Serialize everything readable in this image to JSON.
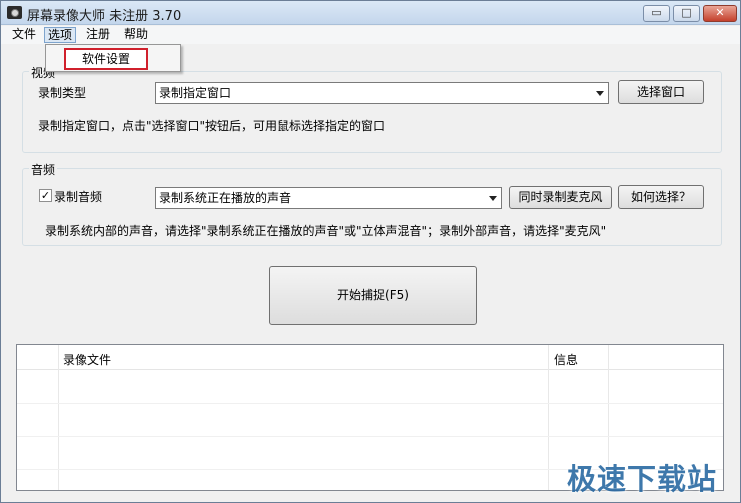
{
  "window": {
    "title": "屏幕录像大师 未注册 3.70",
    "min_label": "▭",
    "max_label": "□",
    "close_label": "✕"
  },
  "menu": {
    "items": [
      "文件",
      "选项",
      "注册",
      "帮助"
    ],
    "dropdown_item": "软件设置"
  },
  "video": {
    "group_label": "视频",
    "type_label": "录制类型",
    "type_value": "录制指定窗口",
    "select_window_button": "选择窗口",
    "hint": "录制指定窗口，点击\"选择窗口\"按钮后，可用鼠标选择指定的窗口"
  },
  "audio": {
    "group_label": "音频",
    "record_audio_label": "录制音频",
    "record_audio_checked": true,
    "source_value": "录制系统正在播放的声音",
    "mic_button": "同时录制麦克风",
    "how_button": "如何选择？",
    "hint": "录制系统内部的声音，请选择\"录制系统正在播放的声音\"或\"立体声混音\"；录制外部声音，请选择\"麦克风\""
  },
  "capture": {
    "start_button": "开始捕捉(F5)"
  },
  "list": {
    "columns": [
      "",
      "录像文件",
      "信息",
      ""
    ]
  },
  "watermark": "极速下载站"
}
